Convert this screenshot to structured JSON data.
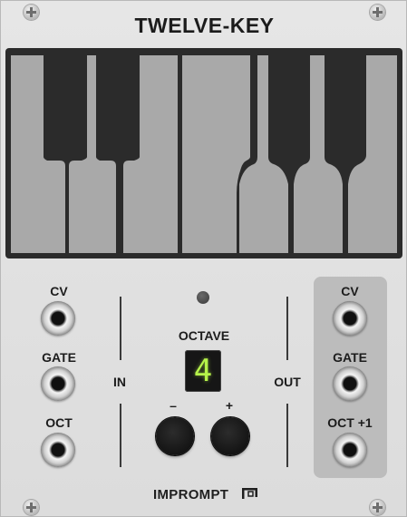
{
  "module": {
    "title": "TWELVE-KEY",
    "brand": "IMPROMPT"
  },
  "inputs": {
    "section_label": "IN",
    "cv_label": "CV",
    "gate_label": "GATE",
    "oct_label": "OCT"
  },
  "outputs": {
    "section_label": "OUT",
    "cv_label": "CV",
    "gate_label": "GATE",
    "oct_label": "OCT +1"
  },
  "octave": {
    "label": "OCTAVE",
    "value": "4",
    "minus_label": "–",
    "plus_label": "+"
  },
  "keyboard": {
    "white_keys": 7,
    "black_keys": 5
  },
  "colors": {
    "panel": "#e2e2e2",
    "key_white": "#a9a9a9",
    "key_black": "#2b2b2b",
    "display_digit": "#b6f24a",
    "output_panel": "#bcbcbc"
  }
}
